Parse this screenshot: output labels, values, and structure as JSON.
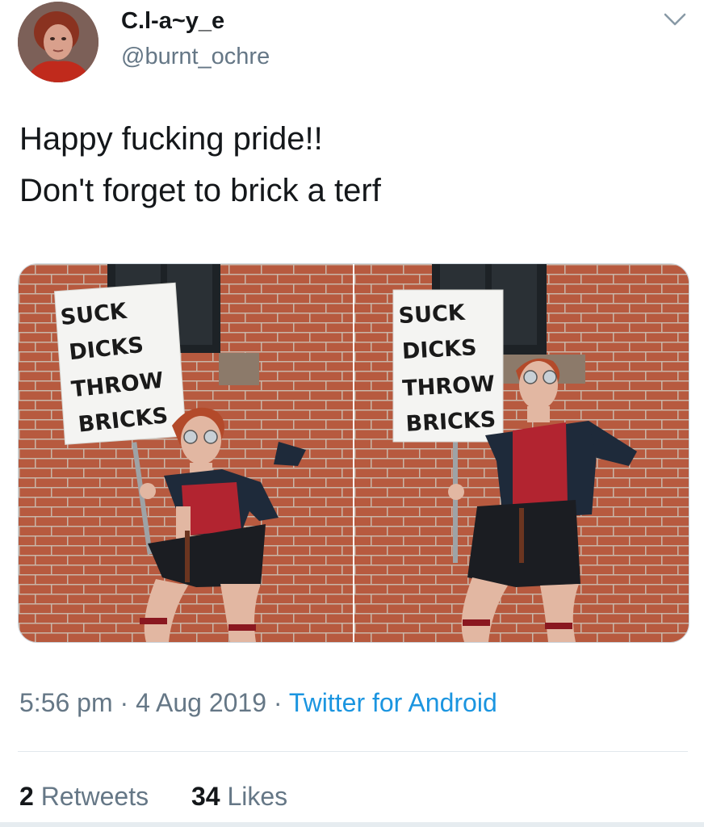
{
  "tweet": {
    "display_name": "C.l-a~y_e",
    "handle": "@burnt_ochre",
    "text_lines": [
      "Happy fucking pride!!",
      "Don't forget to brick a terf"
    ],
    "media": {
      "photos": [
        {
          "sign_lines": [
            "SUCK",
            "DICKS",
            "THROW",
            "BRICKS"
          ]
        },
        {
          "sign_lines": [
            "SUCK",
            "DICKS",
            "THROW",
            "BRICKS"
          ]
        }
      ]
    },
    "time": "5:56 pm",
    "separator": "·",
    "date": "4 Aug 2019",
    "source": "Twitter for Android",
    "retweets_count": "2",
    "retweets_label": "Retweets",
    "likes_count": "34",
    "likes_label": "Likes"
  },
  "icons": {
    "more": "chevron-down-icon"
  },
  "colors": {
    "name": "#14171a",
    "secondary": "#657786",
    "link": "#1b95e0",
    "divider": "#e1e8ed"
  }
}
